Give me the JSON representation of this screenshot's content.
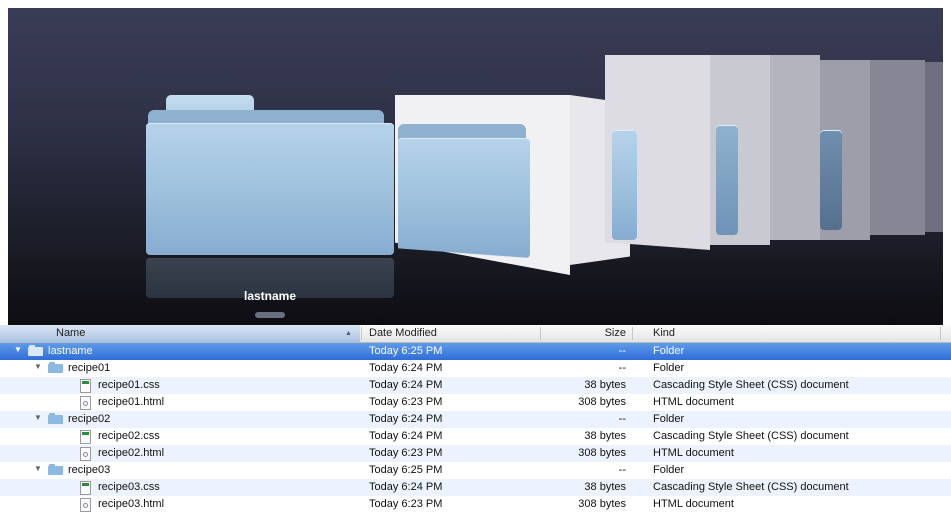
{
  "coverflow": {
    "caption": "lastname"
  },
  "list": {
    "columns": {
      "name": "Name",
      "date": "Date Modified",
      "size": "Size",
      "kind": "Kind"
    },
    "rows": [
      {
        "name": "lastname",
        "date": "Today 6:25 PM",
        "size": "--",
        "kind": "Folder",
        "type": "folder",
        "level": 0,
        "selected": true
      },
      {
        "name": "recipe01",
        "date": "Today 6:24 PM",
        "size": "--",
        "kind": "Folder",
        "type": "folder",
        "level": 1
      },
      {
        "name": "recipe01.css",
        "date": "Today 6:24 PM",
        "size": "38 bytes",
        "kind": "Cascading Style Sheet (CSS) document",
        "type": "css",
        "level": 2
      },
      {
        "name": "recipe01.html",
        "date": "Today 6:23 PM",
        "size": "308 bytes",
        "kind": "HTML document",
        "type": "html",
        "level": 2
      },
      {
        "name": "recipe02",
        "date": "Today 6:24 PM",
        "size": "--",
        "kind": "Folder",
        "type": "folder",
        "level": 1
      },
      {
        "name": "recipe02.css",
        "date": "Today 6:24 PM",
        "size": "38 bytes",
        "kind": "Cascading Style Sheet (CSS) document",
        "type": "css",
        "level": 2
      },
      {
        "name": "recipe02.html",
        "date": "Today 6:23 PM",
        "size": "308 bytes",
        "kind": "HTML document",
        "type": "html",
        "level": 2
      },
      {
        "name": "recipe03",
        "date": "Today 6:25 PM",
        "size": "--",
        "kind": "Folder",
        "type": "folder",
        "level": 1
      },
      {
        "name": "recipe03.css",
        "date": "Today 6:24 PM",
        "size": "38 bytes",
        "kind": "Cascading Style Sheet (CSS) document",
        "type": "css",
        "level": 2
      },
      {
        "name": "recipe03.html",
        "date": "Today 6:23 PM",
        "size": "308 bytes",
        "kind": "HTML document",
        "type": "html",
        "level": 2
      }
    ]
  },
  "colors": {
    "selection": "#3875d7",
    "folder_blue": "#9dc0dc",
    "coverflow_bg": "#2e3146"
  }
}
